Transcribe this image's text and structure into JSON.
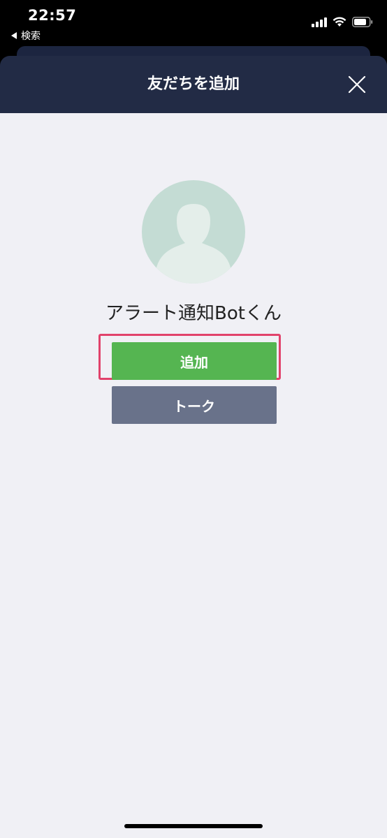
{
  "status_bar": {
    "time": "22:57",
    "back_label": "検索"
  },
  "modal": {
    "title": "友だちを追加"
  },
  "profile": {
    "name": "アラート通知Botくん"
  },
  "buttons": {
    "add_label": "追加",
    "talk_label": "トーク"
  },
  "colors": {
    "header": "#222b45",
    "add_button": "#55b551",
    "talk_button": "#69728a",
    "highlight": "#e1426b",
    "background": "#f0f0f5"
  },
  "icons": {
    "close": "close-icon",
    "avatar": "default-avatar-icon",
    "back": "back-triangle-icon",
    "signal": "cellular-signal-icon",
    "wifi": "wifi-icon",
    "battery": "battery-icon"
  }
}
